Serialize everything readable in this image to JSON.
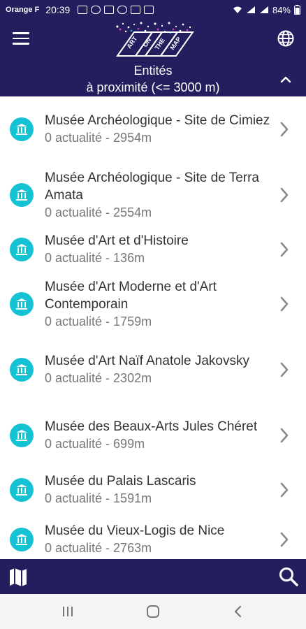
{
  "status_bar": {
    "carrier": "Orange F",
    "time": "20:39",
    "battery": "84%"
  },
  "header": {
    "logo_text": [
      "ART",
      "ON",
      "THE",
      "MAP"
    ],
    "title_line1": "Entités",
    "title_line2": "à proximité (<= 3000 m)"
  },
  "colors": {
    "primary": "#241e5e",
    "accent": "#15c2d4"
  },
  "entities": [
    {
      "name": "Musée Archéologique - Site de Cimiez",
      "meta": "0 actualité - 2954m"
    },
    {
      "name": "Musée Archéologique - Site de Terra Amata",
      "meta": "0 actualité - 2554m"
    },
    {
      "name": "Musée d'Art et d'Histoire",
      "meta": "0 actualité - 136m"
    },
    {
      "name": "Musée d'Art Moderne et d'Art Contemporain",
      "meta": "0 actualité - 1759m"
    },
    {
      "name": "Musée d'Art Naïf Anatole Jakovsky",
      "meta": "0 actualité - 2302m"
    },
    {
      "name": "Musée des Beaux-Arts Jules Chéret",
      "meta": "0 actualité - 699m"
    },
    {
      "name": "Musée du Palais Lascaris",
      "meta": "0 actualité - 1591m"
    },
    {
      "name": "Musée du Vieux-Logis de Nice",
      "meta": "0 actualité - 2763m"
    }
  ],
  "icons": {
    "menu": "menu-icon",
    "globe": "globe-icon",
    "collapse": "chevron-up-icon",
    "item": "museum-icon",
    "chevron": "chevron-right-icon",
    "map": "map-icon",
    "search": "search-icon"
  }
}
